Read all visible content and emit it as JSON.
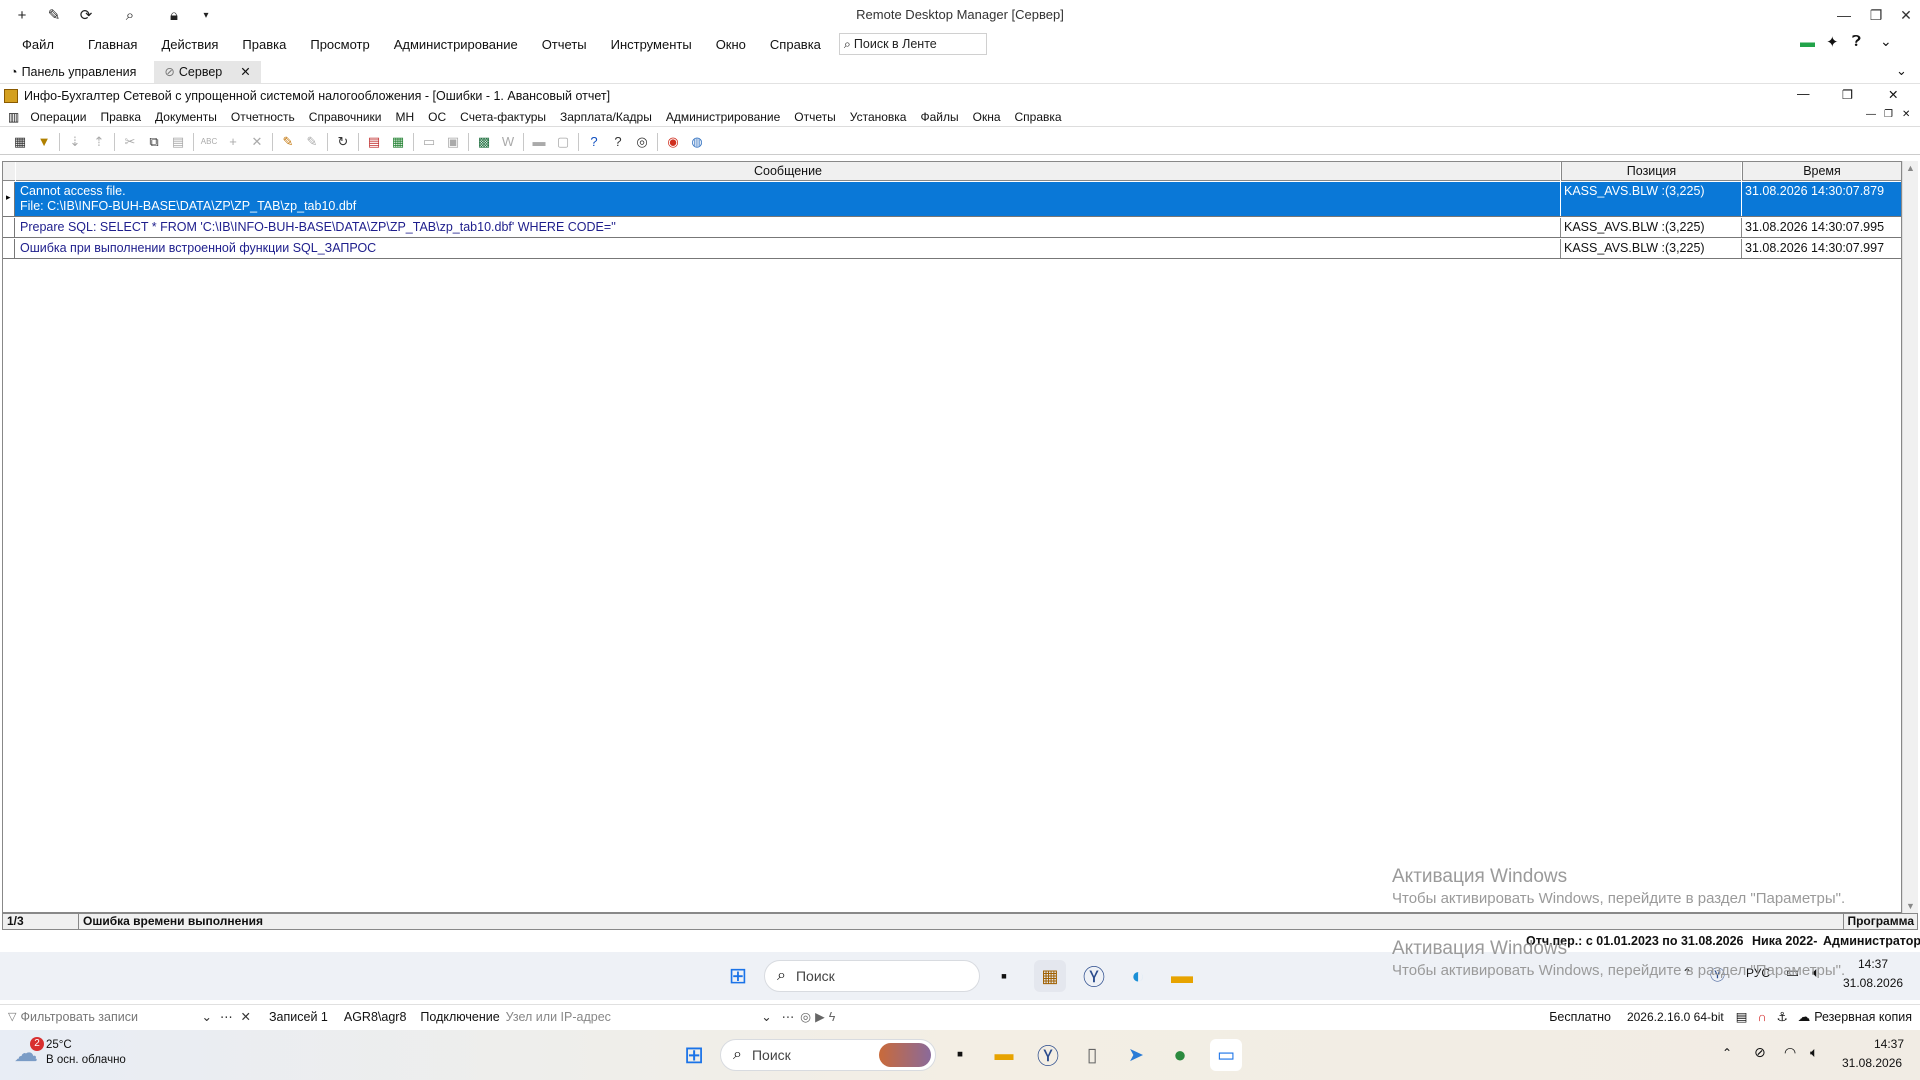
{
  "rdm": {
    "title": "Remote Desktop Manager [Сервер]",
    "menu": [
      "Файл",
      "Главная",
      "Действия",
      "Правка",
      "Просмотр",
      "Администрирование",
      "Отчеты",
      "Инструменты",
      "Окно",
      "Справка"
    ],
    "search_placeholder": "Поиск в Ленте",
    "tabs": [
      {
        "label": "Панель управления",
        "active": false
      },
      {
        "label": "Сервер",
        "active": true
      }
    ]
  },
  "app": {
    "title": "Инфо-Бухгалтер Сетевой с упрощенной системой налогообложения - [Ошибки -   1. Авансовый отчет]",
    "menu": [
      "Операции",
      "Правка",
      "Документы",
      "Отчетность",
      "Справочники",
      "МН",
      "ОС",
      "Счета-фактуры",
      "Зарплата/Кадры",
      "Администрирование",
      "Отчеты",
      "Установка",
      "Файлы",
      "Окна",
      "Справка"
    ]
  },
  "grid": {
    "headers": {
      "message": "Сообщение",
      "position": "Позиция",
      "time": "Время"
    },
    "rows": [
      {
        "message_line1": "Cannot access file.",
        "message_line2": "File: C:\\IB\\INFO-BUH-BASE\\DATA\\ZP\\ZP_TAB\\zp_tab10.dbf",
        "position": "KASS_AVS.BLW :(3,225)",
        "time": "31.08.2026 14:30:07.879",
        "selected": true
      },
      {
        "message_line1": "Prepare SQL: SELECT * FROM 'C:\\IB\\INFO-BUH-BASE\\DATA\\ZP\\ZP_TAB\\zp_tab10.dbf' WHERE CODE=''",
        "position": "KASS_AVS.BLW :(3,225)",
        "time": "31.08.2026 14:30:07.995",
        "selected": false
      },
      {
        "message_line1": "Ошибка при выполнении встроенной функции SQL_ЗАПРОС",
        "position": "KASS_AVS.BLW :(3,225)",
        "time": "31.08.2026 14:30:07.997",
        "selected": false
      }
    ]
  },
  "status": {
    "counter": "1/3",
    "message": "Ошибка времени выполнения",
    "right": "Программа",
    "period": "Отч.пер.: с 01.01.2023 по 31.08.2026",
    "org": "Ника 2022-",
    "user": "Администратор"
  },
  "watermark": {
    "title": "Активация Windows",
    "subtitle": "Чтобы активировать Windows, перейдите в раздел \"Параметры\"."
  },
  "nested_taskbar": {
    "search": "Поиск",
    "lang": "РУС",
    "time": "14:37",
    "date": "31.08.2026"
  },
  "rdm_bottom": {
    "filter_placeholder": "Фильтровать записи",
    "records": "Записей 1",
    "user": "AGR8\\agr8",
    "connection_label": "Подключение",
    "host_placeholder": "Узел или IP-адрес",
    "edition": "Бесплатно",
    "version": "2026.2.16.0 64-bit",
    "backup": "Резервная копия"
  },
  "taskbar": {
    "weather_temp": "25°C",
    "weather_desc": "В осн. облачно",
    "weather_badge": "2",
    "search": "Поиск",
    "time": "14:37",
    "date": "31.08.2026"
  },
  "colors": {
    "selection": "#0a78d7",
    "row_text": "#1e1e8c"
  }
}
